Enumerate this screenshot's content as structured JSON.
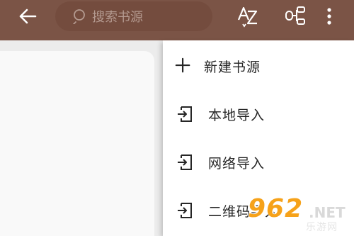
{
  "toolbar": {
    "back_icon": "arrow-left-icon",
    "search_placeholder": "搜索书源",
    "sort_icon": "sort-az-icon",
    "group_icon": "group-icon",
    "more_icon": "more-vert-icon"
  },
  "menu": {
    "items": [
      {
        "label": "新建书源",
        "icon": "plus-icon"
      },
      {
        "label": "本地导入",
        "icon": "import-icon"
      },
      {
        "label": "网络导入",
        "icon": "import-icon"
      },
      {
        "label": "二维码导入",
        "icon": "import-icon"
      }
    ]
  },
  "watermark": {
    "logo": "962",
    "net": ".NET",
    "site": "乐游网"
  },
  "colors": {
    "app_bar": "#7b5446",
    "search_box": "#744c3e",
    "menu_bg": "#ffffff",
    "text": "#262626"
  }
}
